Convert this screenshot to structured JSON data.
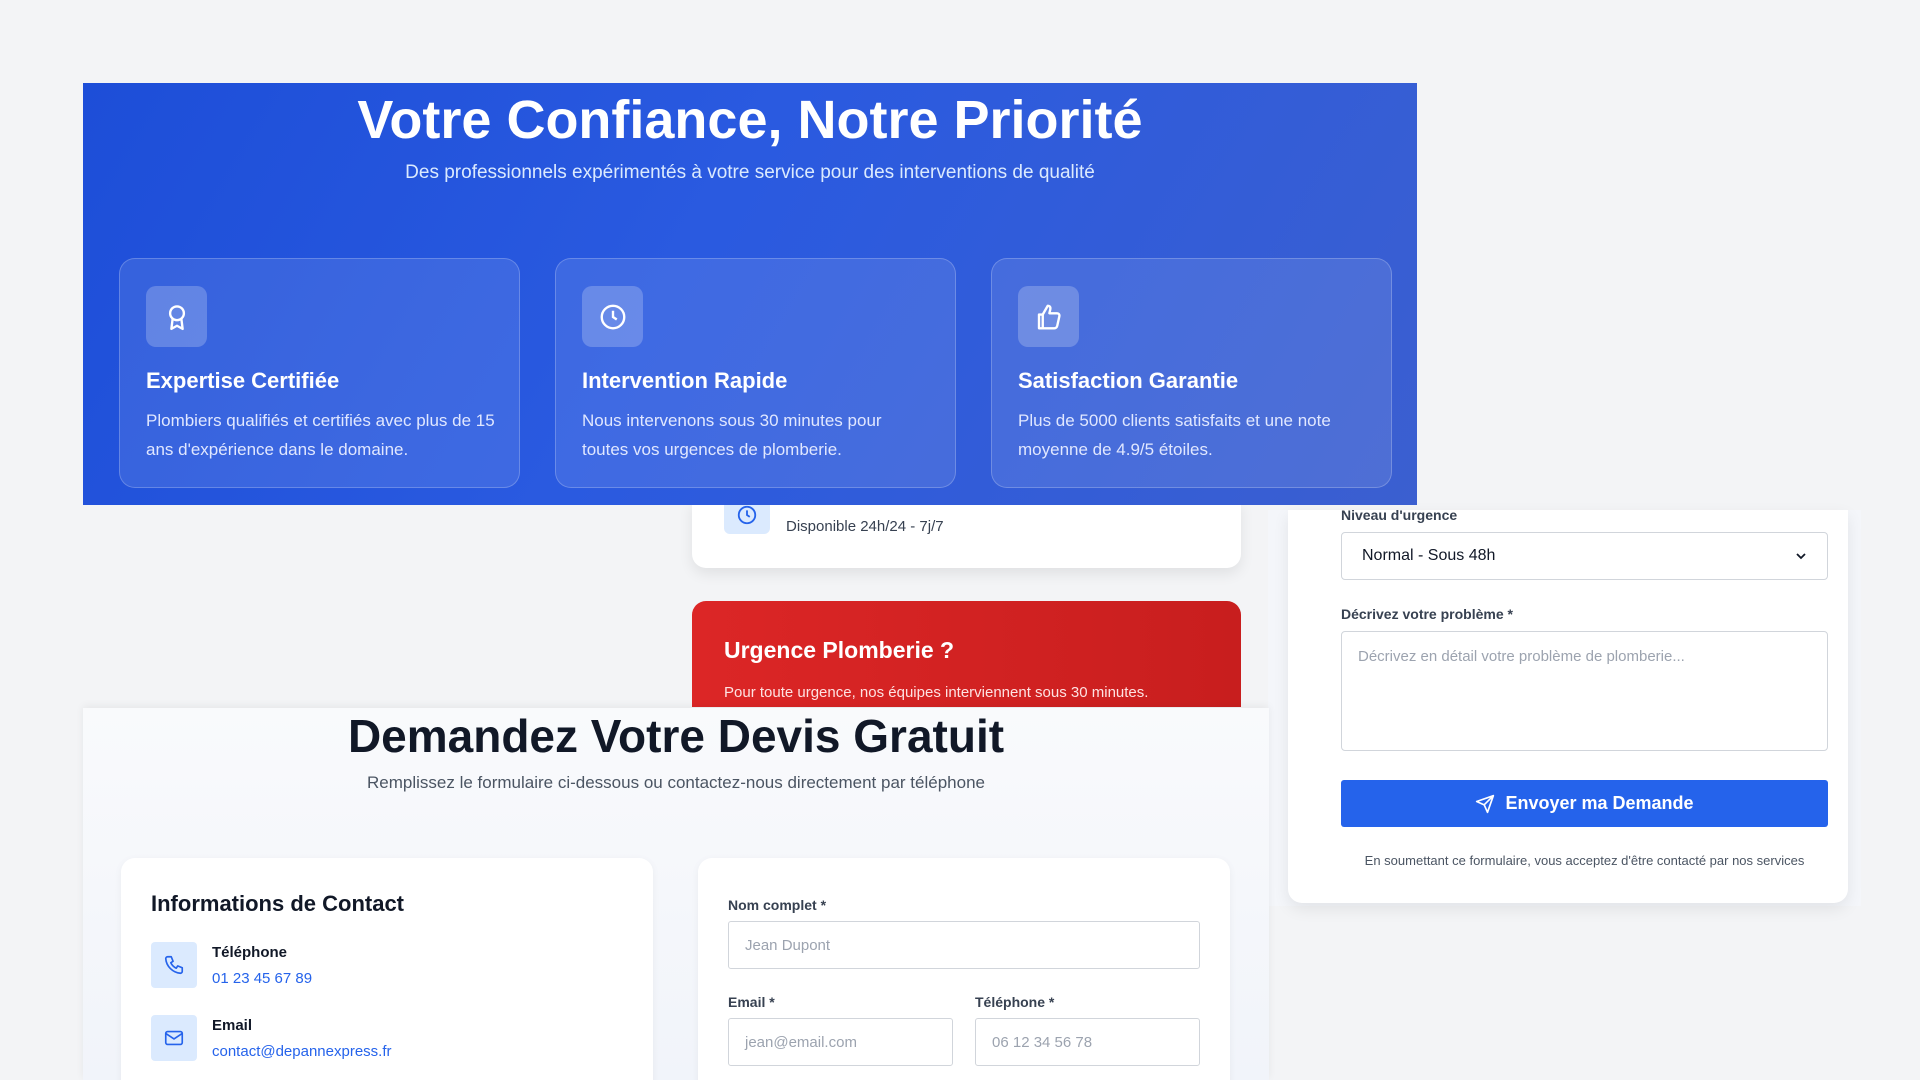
{
  "hero": {
    "title": "Votre Confiance, Notre Priorité",
    "subtitle": "Des professionnels expérimentés à votre service pour des interventions de qualité",
    "features": [
      {
        "icon": "award-icon",
        "title": "Expertise Certifiée",
        "text": "Plombiers qualifiés et certifiés avec plus de 15 ans d'expérience dans le domaine."
      },
      {
        "icon": "clock-icon",
        "title": "Intervention Rapide",
        "text": "Nous intervenons sous 30 minutes pour toutes vos urgences de plomberie."
      },
      {
        "icon": "thumbs-up-icon",
        "title": "Satisfaction Garantie",
        "text": "Plus de 5000 clients satisfaits et une note moyenne de 4.9/5 étoiles."
      }
    ]
  },
  "hours_card": {
    "icon": "clock-icon",
    "text": "Disponible 24h/24 - 7j/7"
  },
  "urgent": {
    "title": "Urgence Plomberie ?",
    "text": "Pour toute urgence, nos équipes interviennent sous 30 minutes."
  },
  "quote_form_right": {
    "urgency_label": "Niveau d'urgence",
    "urgency_value": "Normal - Sous 48h",
    "problem_label": "Décrivez votre problème *",
    "problem_placeholder": "Décrivez en détail votre problème de plomberie...",
    "submit_label": "Envoyer ma Demande",
    "consent_note": "En soumettant ce formulaire, vous acceptez d'être contacté par nos services"
  },
  "quote_section": {
    "title": "Demandez Votre Devis Gratuit",
    "subtitle": "Remplissez le formulaire ci-dessous ou contactez-nous directement par téléphone"
  },
  "contact_info": {
    "title": "Informations de Contact",
    "phone_label": "Téléphone",
    "phone_value": "01 23 45 67 89",
    "email_label": "Email",
    "email_value": "contact@depannexpress.fr"
  },
  "quote_form": {
    "name_label": "Nom complet *",
    "name_placeholder": "Jean Dupont",
    "email_label": "Email *",
    "email_placeholder": "jean@email.com",
    "phone_label": "Téléphone *",
    "phone_placeholder": "06 12 34 56 78"
  },
  "colors": {
    "primary": "#2563eb",
    "hero": "#1d4ed8",
    "urgent": "#dc2626"
  }
}
